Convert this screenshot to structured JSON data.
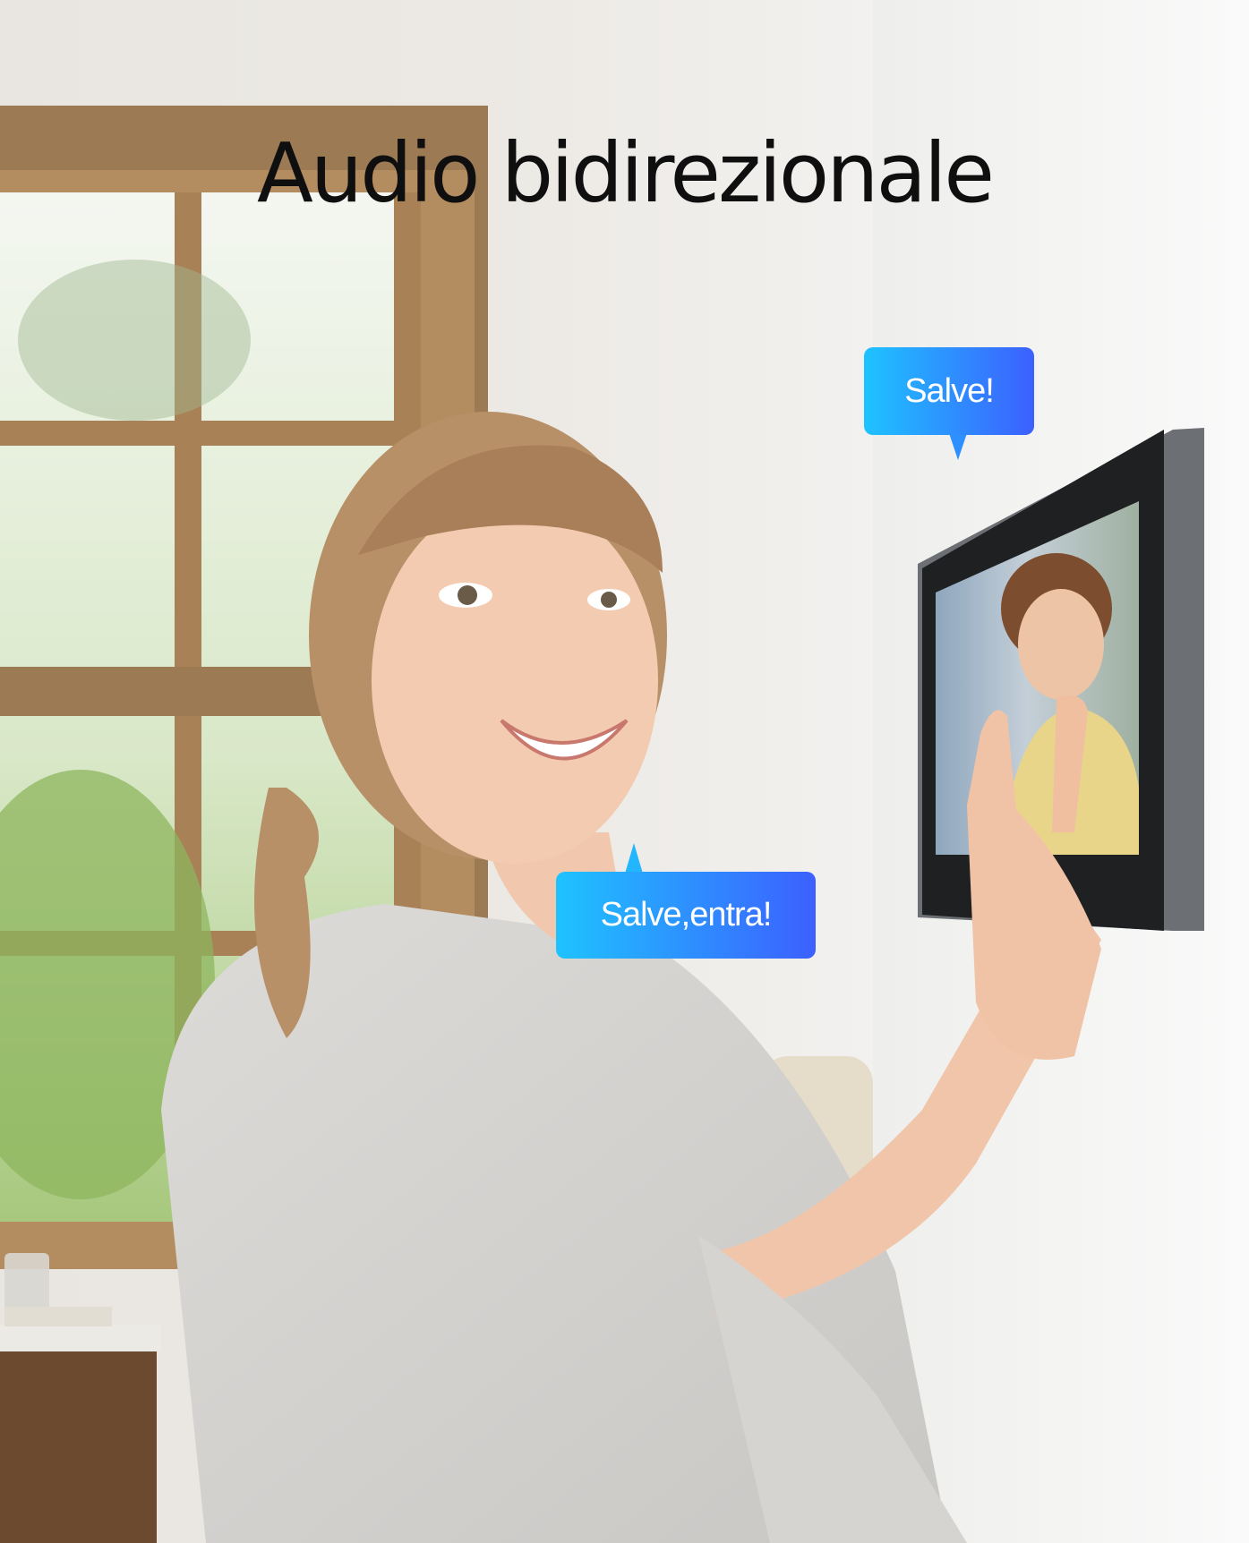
{
  "headline": "Audio bidirezionale",
  "bubbles": {
    "device_message": "Salve!",
    "user_message": "Salve,entra!"
  },
  "colors": {
    "bubble_gradient_start": "#1ec3ff",
    "bubble_gradient_end": "#3c60ff",
    "headline_text": "#0f0f10",
    "bubble_text": "#ffffff"
  }
}
